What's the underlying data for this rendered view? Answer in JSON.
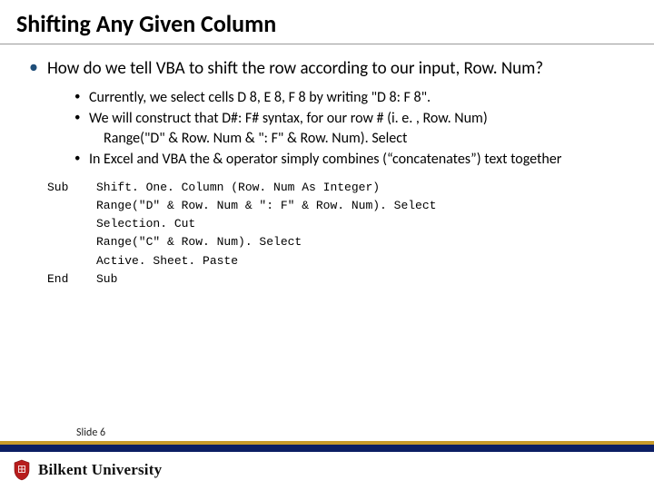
{
  "title": "Shifting Any Given Column",
  "main_bullet": "How do we tell VBA to shift the row according to our input, Row. Num?",
  "subs": {
    "s1": "Currently, we select cells D 8, E 8, F 8 by writing \"D 8: F 8\".",
    "s2": "We will construct that D#: F# syntax, for our row # (i. e. , Row. Num)",
    "s2b": "Range(\"D\"  &  Row. Num  &  \": F\"  &  Row. Num). Select",
    "s3": "In Excel and VBA the & operator simply combines (“concatenates”) text together"
  },
  "code": {
    "r1c0": "Sub",
    "r1c1": "Shift. One. Column  (Row. Num   As    Integer)",
    "r2c1": "Range(\"D\"    &  Row. Num   &    \": F\"  &    Row. Num). Select",
    "r3c1": "Selection. Cut",
    "r4c1": "Range(\"C\"    &  Row. Num). Select",
    "r5c1": "Active. Sheet. Paste",
    "r6c0": "End",
    "r6c1": "Sub"
  },
  "slide_label": "Slide 6",
  "university": "Bilkent University"
}
